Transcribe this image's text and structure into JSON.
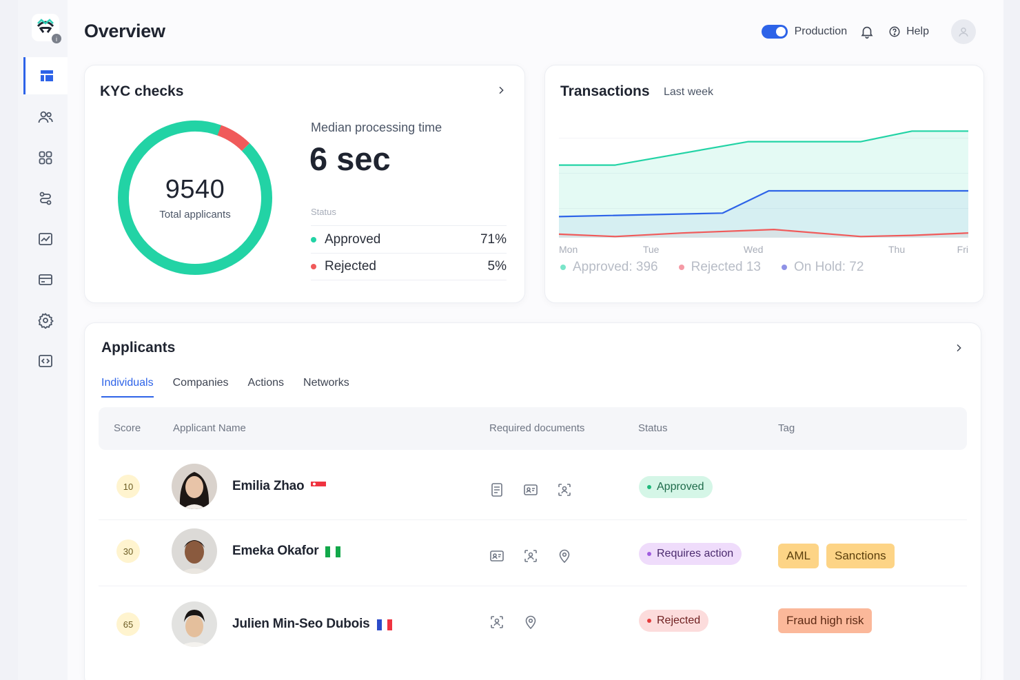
{
  "page": {
    "title": "Overview"
  },
  "topbar": {
    "environment_label": "Production",
    "help_label": "Help"
  },
  "sidebar": {
    "items": [
      {
        "icon": "dashboard-icon",
        "active": true
      },
      {
        "icon": "users-icon",
        "active": false
      },
      {
        "icon": "apps-grid-icon",
        "active": false
      },
      {
        "icon": "workflow-icon",
        "active": false
      },
      {
        "icon": "analytics-icon",
        "active": false
      },
      {
        "icon": "billing-card-icon",
        "active": false
      },
      {
        "icon": "settings-gear-icon",
        "active": false
      },
      {
        "icon": "developer-code-icon",
        "active": false
      }
    ]
  },
  "kyc": {
    "title": "KYC checks",
    "total": "9540",
    "total_label": "Total applicants",
    "median_label": "Median processing time",
    "median_value": "6 sec",
    "status_label": "Status",
    "statuses": [
      {
        "label": "Approved",
        "pct": "71%",
        "color": "#22d3a5"
      },
      {
        "label": "Rejected",
        "pct": "5%",
        "color": "#f05a5a"
      }
    ],
    "donut": {
      "approved_fraction": 0.93,
      "rejected_fraction": 0.07
    }
  },
  "transactions": {
    "title": "Transactions",
    "period": "Last week",
    "legend": [
      {
        "text": "Approved: 396",
        "color": "#22d3a5"
      },
      {
        "text": "Rejected  13",
        "color": "#f59aa5"
      },
      {
        "text": "On Hold: 72",
        "color": "#8f92e6"
      }
    ]
  },
  "chart_data": {
    "type": "area",
    "categories": [
      "Mon",
      "Tue",
      "Wed",
      "Thu",
      "Fri"
    ],
    "x_positions": [
      0,
      0.9,
      1.9,
      3.3,
      4.0
    ],
    "series": [
      {
        "name": "Approved",
        "color": "#22d3a5",
        "x": [
          0,
          0.55,
          1.85,
          2.95,
          3.45,
          4.0
        ],
        "values": [
          62,
          62,
          82,
          82,
          91,
          91
        ]
      },
      {
        "name": "On Hold",
        "color": "#2d63e8",
        "x": [
          0,
          1.6,
          2.05,
          2.95,
          4.0
        ],
        "values": [
          18,
          21,
          40,
          40,
          40
        ]
      },
      {
        "name": "Rejected",
        "color": "#f05a5a",
        "x": [
          0,
          0.55,
          1.2,
          2.1,
          2.95,
          3.45,
          4.0
        ],
        "values": [
          3,
          1,
          4,
          7,
          1,
          2,
          4
        ]
      }
    ],
    "ylim": [
      0,
      100
    ],
    "grid": false
  },
  "applicants": {
    "title": "Applicants",
    "tabs": [
      {
        "label": "Individuals",
        "active": true
      },
      {
        "label": "Companies",
        "active": false
      },
      {
        "label": "Actions",
        "active": false
      },
      {
        "label": "Networks",
        "active": false
      }
    ],
    "columns": [
      "Score",
      "Applicant Name",
      "Required documents",
      "Status",
      "Tag"
    ],
    "rows": [
      {
        "score": "10",
        "name": "Emilia Zhao",
        "flag": "singapore-flag",
        "documents": [
          "document-icon",
          "id-card-icon",
          "face-scan-icon"
        ],
        "status": "Approved",
        "status_style": "approved",
        "tags": []
      },
      {
        "score": "30",
        "name": "Emeka Okafor",
        "flag": "nigeria-flag",
        "documents": [
          "id-card-icon",
          "face-scan-icon",
          "location-pin-icon"
        ],
        "status": "Requires action",
        "status_style": "action",
        "tags": [
          "AML",
          "Sanctions"
        ]
      },
      {
        "score": "65",
        "name": "Julien Min-Seo Dubois",
        "flag": "france-flag",
        "documents": [
          "face-scan-icon",
          "location-pin-icon"
        ],
        "status": "Rejected",
        "status_style": "rejected",
        "tags": [
          "Fraud high risk"
        ]
      }
    ]
  }
}
